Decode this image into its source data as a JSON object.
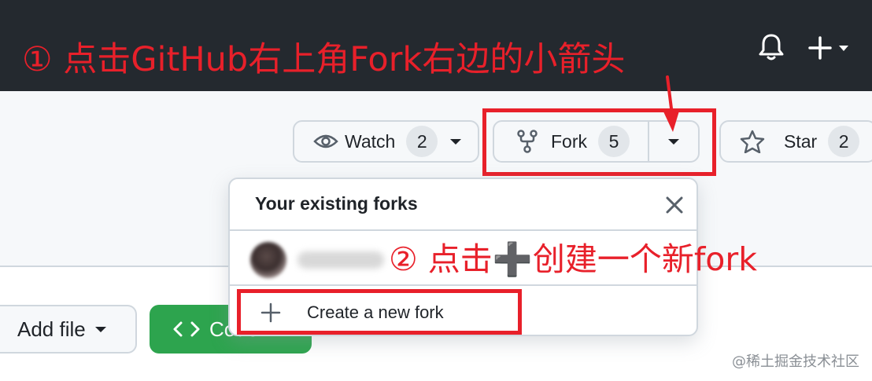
{
  "annotations": {
    "step1": "① 点击GitHub右上角Fork右边的小箭头",
    "step2": "② 点击➕创建一个新fork"
  },
  "header": {
    "icons": [
      "bell-icon",
      "plus-icon",
      "chevron-down-icon"
    ]
  },
  "repo_actions": {
    "watch": {
      "label": "Watch",
      "count": "2"
    },
    "fork": {
      "label": "Fork",
      "count": "5"
    },
    "star": {
      "label": "Star",
      "count": "2"
    }
  },
  "fork_popup": {
    "title": "Your existing forks",
    "create_label": "Create a new fork"
  },
  "content": {
    "add_file_label": "Add file",
    "code_label": "Code"
  },
  "watermark": "@稀土掘金技术社区",
  "colors": {
    "annotation_red": "#e8202a",
    "header_bg": "#24292f",
    "code_green": "#2da44e"
  }
}
